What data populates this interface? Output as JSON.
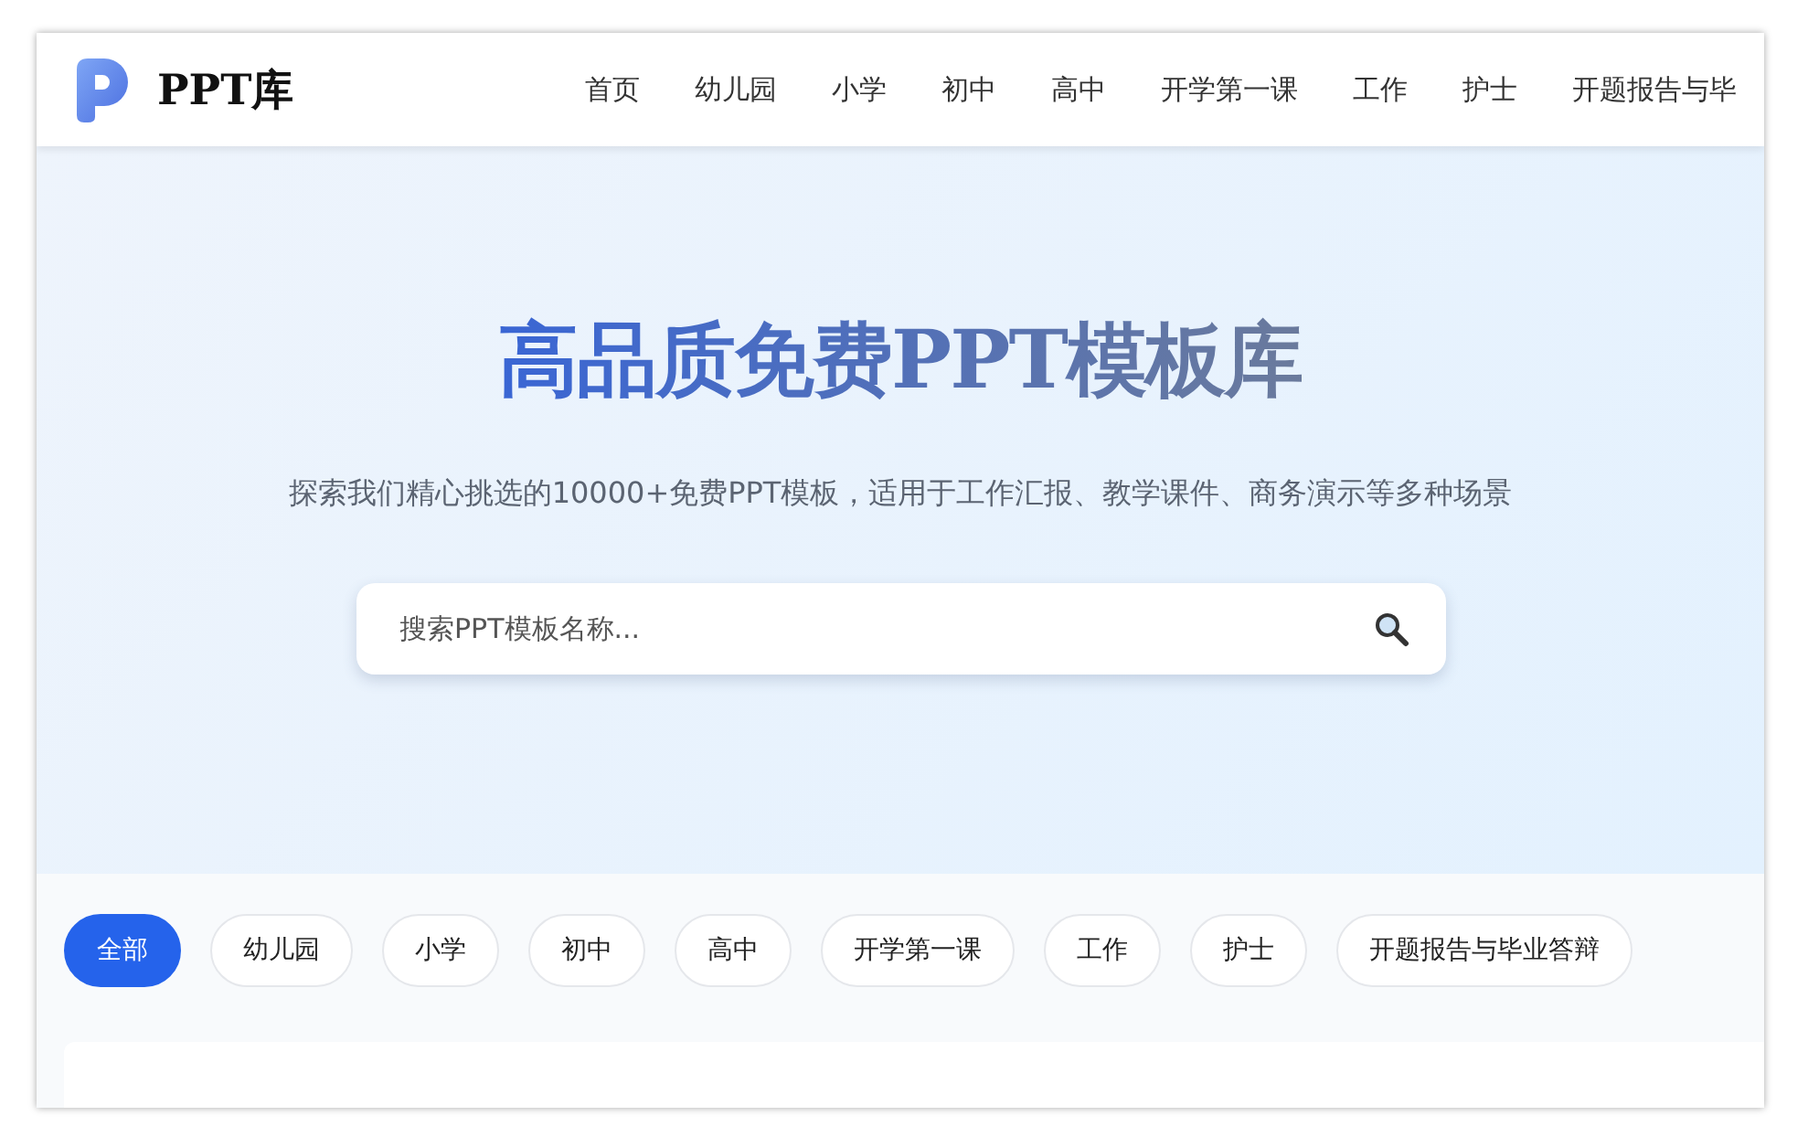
{
  "header": {
    "logo_text": "PPT库",
    "nav": [
      {
        "label": "首页"
      },
      {
        "label": "幼儿园"
      },
      {
        "label": "小学"
      },
      {
        "label": "初中"
      },
      {
        "label": "高中"
      },
      {
        "label": "开学第一课"
      },
      {
        "label": "工作"
      },
      {
        "label": "护士"
      },
      {
        "label": "开题报告与毕"
      }
    ]
  },
  "hero": {
    "title": "高品质免费PPT模板库",
    "subtitle": "探索我们精心挑选的10000+免费PPT模板，适用于工作汇报、教学课件、商务演示等多种场景",
    "search": {
      "placeholder": "搜索PPT模板名称..."
    }
  },
  "filters": [
    {
      "label": "全部",
      "selected": true
    },
    {
      "label": "幼儿园",
      "selected": false
    },
    {
      "label": "小学",
      "selected": false
    },
    {
      "label": "初中",
      "selected": false
    },
    {
      "label": "高中",
      "selected": false
    },
    {
      "label": "开学第一课",
      "selected": false
    },
    {
      "label": "工作",
      "selected": false
    },
    {
      "label": "护士",
      "selected": false
    },
    {
      "label": "开题报告与毕业答辩",
      "selected": false
    }
  ]
}
